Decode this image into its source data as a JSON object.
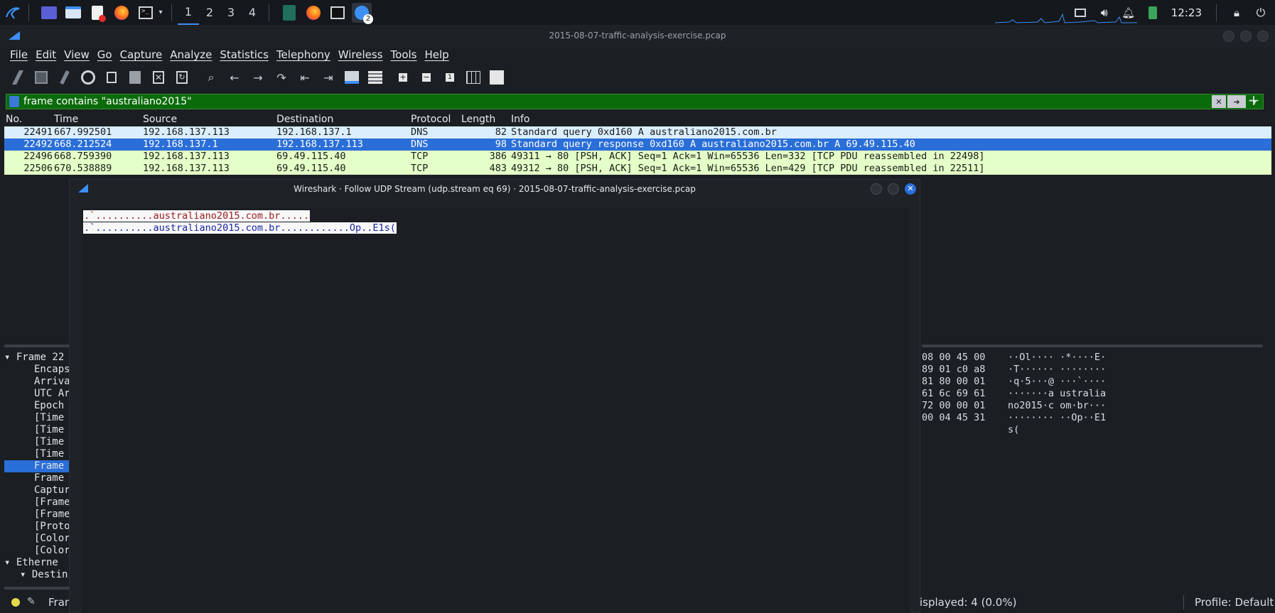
{
  "taskbar": {
    "workspaces": [
      "1",
      "2",
      "3",
      "4"
    ],
    "active_workspace": "1",
    "notification_badge": "2",
    "clock": "12:23"
  },
  "window": {
    "title": "2015-08-07-traffic-analysis-exercise.pcap"
  },
  "menu": [
    "File",
    "Edit",
    "View",
    "Go",
    "Capture",
    "Analyze",
    "Statistics",
    "Telephony",
    "Wireless",
    "Tools",
    "Help"
  ],
  "filter": {
    "value": "frame contains \"australiano2015\""
  },
  "packet_list": {
    "headers": [
      "No.",
      "Time",
      "Source",
      "Destination",
      "Protocol",
      "Length",
      "Info"
    ],
    "rows": [
      {
        "no": "22491",
        "time": "667.992501",
        "src": "192.168.137.113",
        "dst": "192.168.137.1",
        "proto": "DNS",
        "len": "82",
        "info": "Standard query 0xd160 A australiano2015.com.br"
      },
      {
        "no": "22492",
        "time": "668.212524",
        "src": "192.168.137.1",
        "dst": "192.168.137.113",
        "proto": "DNS",
        "len": "98",
        "info": "Standard query response 0xd160 A australiano2015.com.br A 69.49.115.40"
      },
      {
        "no": "22496",
        "time": "668.759390",
        "src": "192.168.137.113",
        "dst": "69.49.115.40",
        "proto": "TCP",
        "len": "386",
        "info": "49311 → 80 [PSH, ACK] Seq=1 Ack=1 Win=65536 Len=332 [TCP PDU reassembled in 22498]"
      },
      {
        "no": "22506",
        "time": "670.538889",
        "src": "192.168.137.113",
        "dst": "69.49.115.40",
        "proto": "TCP",
        "len": "483",
        "info": "49312 → 80 [PSH, ACK] Seq=1 Ack=1 Win=65536 Len=429 [TCP PDU reassembled in 22511]"
      }
    ]
  },
  "details": [
    "Frame 22",
    "Encaps",
    "Arriva",
    "UTC Ar",
    "Epoch",
    "[Time",
    "[Time",
    "[Time",
    "[Time",
    "Frame",
    "Frame",
    "Captur",
    "[Frame",
    "[Frame",
    "[Proto",
    "[Color",
    "[Color",
    "Etherne",
    "Destin"
  ],
  "hex": [
    {
      "bytes": "08 00 45 00",
      "ascii": "··Ol···· ·*····E·"
    },
    {
      "bytes": "89 01 c0 a8",
      "ascii": "·T······ ········"
    },
    {
      "bytes": "81 80 00 01",
      "ascii": "·q·5···@ ···`····"
    },
    {
      "bytes": "61 6c 69 61",
      "ascii": "·······a ustralia"
    },
    {
      "bytes": "72 00 00 01",
      "ascii": "no2015·c om·br···"
    },
    {
      "bytes": "00 04 45 31",
      "ascii": "········ ··Op··E1"
    },
    {
      "bytes": "",
      "ascii": "s("
    }
  ],
  "status": {
    "frame_label": "Fram",
    "displayed": "isplayed: 4 (0.0%)",
    "profile": "Profile: Default"
  },
  "follow_dialog": {
    "title": "Wireshark · Follow UDP Stream (udp.stream eq 69) · 2015-08-07-traffic-analysis-exercise.pcap",
    "client_line": ".`..........australiano2015.com.br.....",
    "server_line": ".`..........australiano2015.com.br............Op..E1s("
  },
  "colors": {
    "filter_valid": "#0a6b0a",
    "selected_row": "#2a6ed8",
    "dns_row": "#daeefe",
    "tcp_row": "#e4ffc7",
    "client_text": "#9b1a1a",
    "server_text": "#1a27a0"
  }
}
